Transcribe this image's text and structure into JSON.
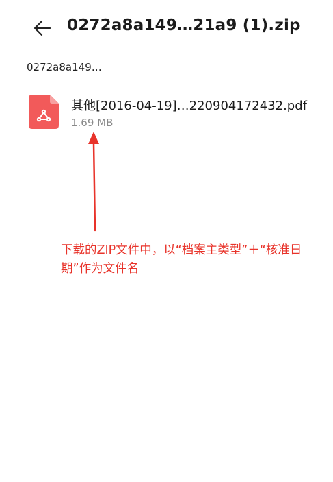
{
  "header": {
    "title": "0272a8a149…21a9 (1).zip",
    "back_icon": "arrow-left-icon"
  },
  "breadcrumb": {
    "path": "0272a8a149…"
  },
  "files": [
    {
      "name": "其他[2016-04-19]…220904172432.pdf",
      "size": "1.69 MB",
      "icon": "pdf-file-icon",
      "icon_color": "#f25a5a"
    }
  ],
  "annotation": {
    "text": "下载的ZIP文件中，以“档案主类型”＋“核准日期”作为文件名",
    "color": "#e8332a"
  }
}
